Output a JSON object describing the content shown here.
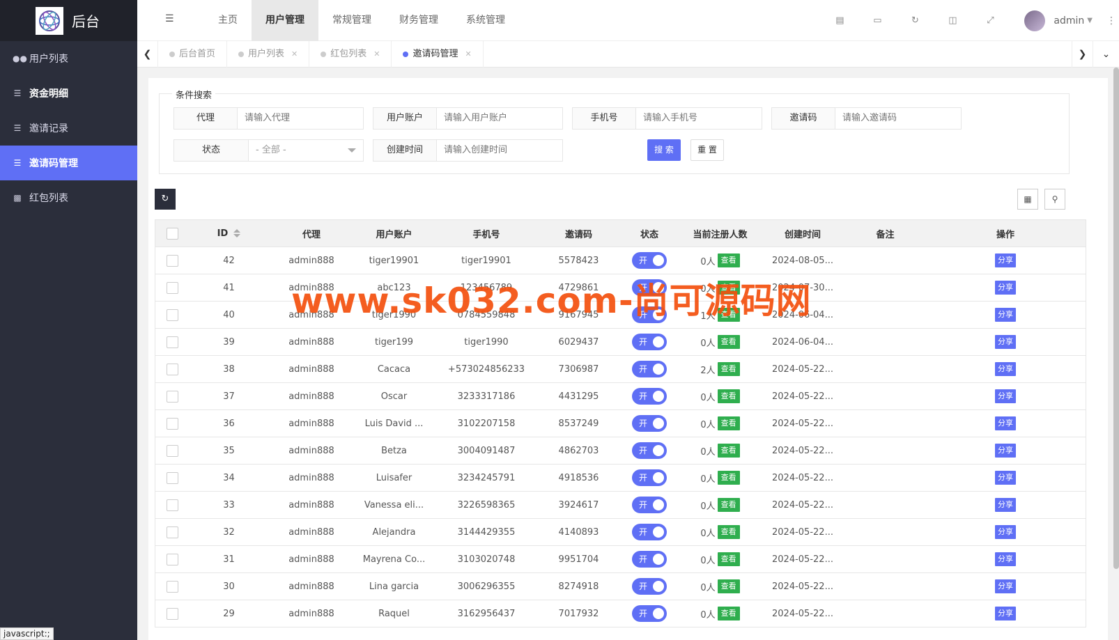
{
  "app": {
    "title": "后台"
  },
  "sidebar": {
    "items": [
      {
        "label": "用户列表",
        "icon": "users-icon"
      },
      {
        "label": "资金明细",
        "icon": "list-icon"
      },
      {
        "label": "邀请记录",
        "icon": "list-icon"
      },
      {
        "label": "邀请码管理",
        "icon": "list-icon",
        "active": true
      },
      {
        "label": "红包列表",
        "icon": "envelope-icon"
      }
    ]
  },
  "header": {
    "nav": [
      "主页",
      "用户管理",
      "常规管理",
      "财务管理",
      "系统管理"
    ],
    "active_nav": "用户管理",
    "username": "admin"
  },
  "tabs": [
    {
      "label": "后台首页"
    },
    {
      "label": "用户列表"
    },
    {
      "label": "红包列表"
    },
    {
      "label": "邀请码管理",
      "active": true
    }
  ],
  "search": {
    "legend": "条件搜索",
    "agent": {
      "label": "代理",
      "placeholder": "请输入代理"
    },
    "account": {
      "label": "用户账户",
      "placeholder": "请输入用户账户"
    },
    "phone": {
      "label": "手机号",
      "placeholder": "请输入手机号"
    },
    "code": {
      "label": "邀请码",
      "placeholder": "请输入邀请码"
    },
    "status": {
      "label": "状态",
      "value": "- 全部 -"
    },
    "created": {
      "label": "创建时间",
      "placeholder": "请输入创建时间"
    },
    "search_btn": "搜 索",
    "reset_btn": "重 置"
  },
  "table": {
    "headers": [
      "ID",
      "代理",
      "用户账户",
      "手机号",
      "邀请码",
      "状态",
      "当前注册人数",
      "创建时间",
      "备注",
      "操作"
    ],
    "switch_label": "开",
    "view_label": "查看",
    "share_label": "分享",
    "rows": [
      {
        "id": "42",
        "agent": "admin888",
        "user": "tiger19901",
        "phone": "tiger19901",
        "code": "5578423",
        "count": "0人",
        "time": "2024-08-05..."
      },
      {
        "id": "41",
        "agent": "admin888",
        "user": "abc123",
        "phone": "123456789",
        "code": "4729861",
        "count": "0人",
        "time": "2024-07-30..."
      },
      {
        "id": "40",
        "agent": "admin888",
        "user": "tiger1990",
        "phone": "0784559848",
        "code": "9167945",
        "count": "1人",
        "time": "2024-06-04..."
      },
      {
        "id": "39",
        "agent": "admin888",
        "user": "tiger199",
        "phone": "tiger1990",
        "code": "6029437",
        "count": "0人",
        "time": "2024-06-04..."
      },
      {
        "id": "38",
        "agent": "admin888",
        "user": "Cacaca",
        "phone": "+573024856233",
        "code": "7306987",
        "count": "2人",
        "time": "2024-05-22..."
      },
      {
        "id": "37",
        "agent": "admin888",
        "user": "Oscar",
        "phone": "3233317186",
        "code": "4431295",
        "count": "0人",
        "time": "2024-05-22..."
      },
      {
        "id": "36",
        "agent": "admin888",
        "user": "Luis David ...",
        "phone": "3102207158",
        "code": "8537249",
        "count": "0人",
        "time": "2024-05-22..."
      },
      {
        "id": "35",
        "agent": "admin888",
        "user": "Betza",
        "phone": "3004091487",
        "code": "4862703",
        "count": "0人",
        "time": "2024-05-22..."
      },
      {
        "id": "34",
        "agent": "admin888",
        "user": "Luisafer",
        "phone": "3234245791",
        "code": "4918536",
        "count": "0人",
        "time": "2024-05-22..."
      },
      {
        "id": "33",
        "agent": "admin888",
        "user": "Vanessa eli...",
        "phone": "3226598365",
        "code": "3924617",
        "count": "0人",
        "time": "2024-05-22..."
      },
      {
        "id": "32",
        "agent": "admin888",
        "user": "Alejandra",
        "phone": "3144429355",
        "code": "4140893",
        "count": "0人",
        "time": "2024-05-22..."
      },
      {
        "id": "31",
        "agent": "admin888",
        "user": "Mayrena Co...",
        "phone": "3103020748",
        "code": "9951704",
        "count": "0人",
        "time": "2024-05-22..."
      },
      {
        "id": "30",
        "agent": "admin888",
        "user": "Lina garcia",
        "phone": "3006296355",
        "code": "8274918",
        "count": "0人",
        "time": "2024-05-22..."
      },
      {
        "id": "29",
        "agent": "admin888",
        "user": "Raquel",
        "phone": "3162956437",
        "code": "7017932",
        "count": "0人",
        "time": "2024-05-22..."
      }
    ]
  },
  "watermark": "www.sk032.com-尚可源码网",
  "status_bar": "javascript:;",
  "colors": {
    "accent": "#5f6ff5",
    "sidebar": "#2b2e3b",
    "view": "#2fae4e",
    "watermark": "#f4500e"
  }
}
